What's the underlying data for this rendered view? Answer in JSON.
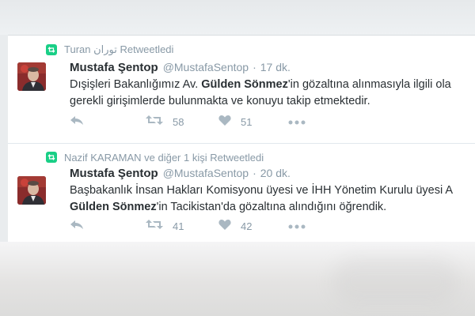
{
  "colors": {
    "retweet_green": "#19cf86",
    "text_primary": "#292f33",
    "text_secondary": "#8899a6",
    "icon_gray": "#aab8c2"
  },
  "tweets": [
    {
      "retweeted_by": "Turan توران Retweetledi",
      "name": "Mustafa Şentop",
      "handle": "@MustafaSentop",
      "separator": "·",
      "time": "17 dk.",
      "lines": [
        {
          "pre": "Dışişleri Bakanlığımız Av. ",
          "bold": "Gülden Sönmez",
          "post": "'in gözaltına alınmasıyla ilgili ola"
        },
        {
          "pre": "gerekli girişimlerde bulunmakta ve konuyu takip etmektedir.",
          "bold": "",
          "post": ""
        }
      ],
      "retweet_count": "58",
      "like_count": "51"
    },
    {
      "retweeted_by": "Nazif KARAMAN ve diğer 1 kişi Retweetledi",
      "name": "Mustafa Şentop",
      "handle": "@MustafaSentop",
      "separator": "·",
      "time": "20 dk.",
      "lines": [
        {
          "pre": "Başbakanlık İnsan Hakları Komisyonu üyesi ve İHH Yönetim Kurulu üyesi A",
          "bold": "",
          "post": ""
        },
        {
          "pre": "",
          "bold": "Gülden Sönmez",
          "post": "'in Tacikistan'da gözaltına alındığını öğrendik."
        }
      ],
      "retweet_count": "41",
      "like_count": "42"
    }
  ],
  "icons": {
    "retweet_badge": "retweet-icon",
    "reply": "reply-icon",
    "retweet": "retweet-icon",
    "like": "heart-icon",
    "more": "more-dots-icon"
  }
}
